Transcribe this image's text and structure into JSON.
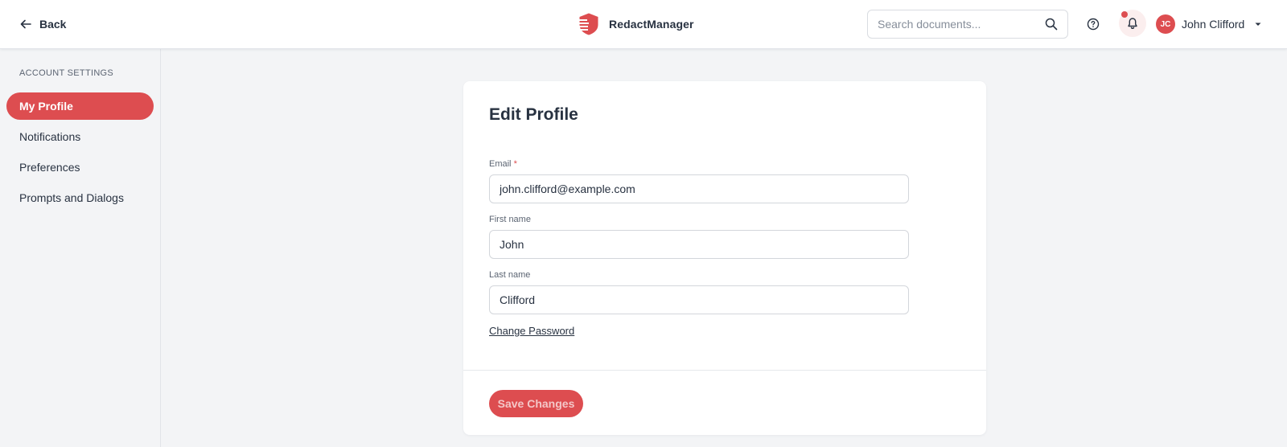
{
  "header": {
    "back_label": "Back",
    "brand_name": "RedactManager",
    "search": {
      "placeholder": "Search documents...",
      "value": ""
    },
    "user": {
      "initials": "JC",
      "name": "John Clifford"
    },
    "has_unread_notifications": true
  },
  "sidebar": {
    "heading": "ACCOUNT SETTINGS",
    "items": [
      {
        "label": "My Profile",
        "active": true
      },
      {
        "label": "Notifications",
        "active": false
      },
      {
        "label": "Preferences",
        "active": false
      },
      {
        "label": "Prompts and Dialogs",
        "active": false
      }
    ]
  },
  "form": {
    "title": "Edit Profile",
    "email": {
      "label": "Email",
      "required_marker": "*",
      "value": "john.clifford@example.com"
    },
    "first_name": {
      "label": "First name",
      "value": "John"
    },
    "last_name": {
      "label": "Last name",
      "value": "Clifford"
    },
    "change_password_label": "Change Password",
    "save_label": "Save Changes"
  },
  "colors": {
    "accent": "#dd4d50",
    "background": "#f3f4f6",
    "text": "#283241"
  }
}
